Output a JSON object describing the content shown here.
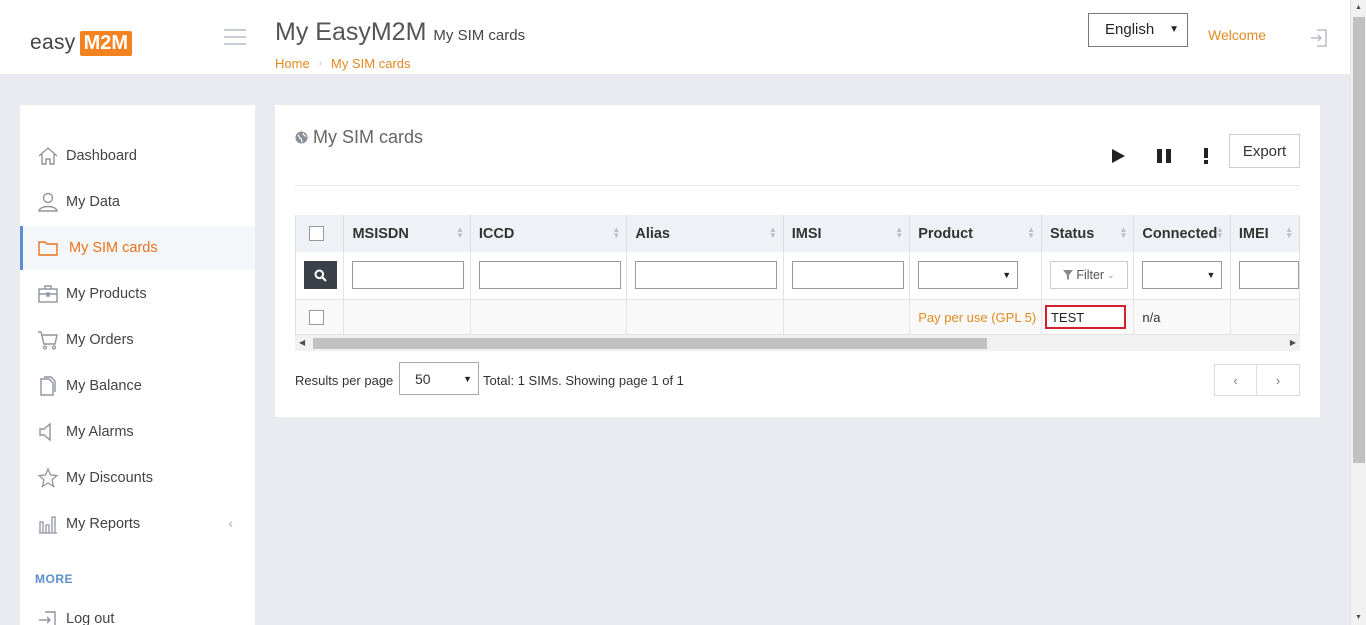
{
  "header": {
    "logo_easy": "easy",
    "logo_m2m": "M2M",
    "title": "My EasyM2M",
    "subtitle": "My SIM cards",
    "breadcrumb": [
      "Home",
      "My SIM cards"
    ],
    "language": "English",
    "welcome": "Welcome"
  },
  "sidebar": {
    "items": [
      {
        "label": "Dashboard",
        "icon": "home-icon"
      },
      {
        "label": "My Data",
        "icon": "user-icon"
      },
      {
        "label": "My SIM cards",
        "icon": "folder-icon",
        "active": true
      },
      {
        "label": "My Products",
        "icon": "briefcase-icon"
      },
      {
        "label": "My Orders",
        "icon": "cart-icon"
      },
      {
        "label": "My Balance",
        "icon": "document-icon"
      },
      {
        "label": "My Alarms",
        "icon": "speaker-icon"
      },
      {
        "label": "My Discounts",
        "icon": "star-icon"
      },
      {
        "label": "My Reports",
        "icon": "bar-chart-icon"
      }
    ],
    "more_label": "MORE",
    "logout_label": "Log out"
  },
  "panel": {
    "title": "My SIM cards",
    "export_label": "Export",
    "columns": [
      "MSISDN",
      "ICCD",
      "Alias",
      "IMSI",
      "Product",
      "Status",
      "Connected",
      "IMEI"
    ],
    "filter_button": "Filter",
    "rows": [
      {
        "msisdn": "",
        "iccd": "",
        "alias": "",
        "imsi": "",
        "product": "Pay per use (GPL 5)",
        "status": "TEST",
        "connected": "n/a",
        "imei": ""
      }
    ],
    "results_per_page_label": "Results per page",
    "results_per_page_value": "50",
    "total_text": "Total: 1 SIMs. Showing page 1 of 1",
    "prev_glyph": "‹",
    "next_glyph": "›"
  },
  "colors": {
    "accent_orange": "#e28a21",
    "brand_orange": "#f58220",
    "active_blue": "#5a8fd6",
    "status_border": "#d0212d"
  }
}
